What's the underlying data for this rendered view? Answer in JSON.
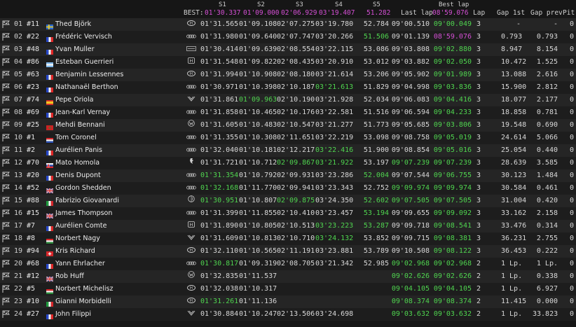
{
  "header": {
    "s1": "S1",
    "s2": "S2",
    "s3": "S3",
    "s4": "S4",
    "s5": "S5",
    "best_label": "BEST:",
    "best_s1": "01'30.337",
    "best_s2": "01'09.000",
    "best_s3": "02'06.929",
    "best_s4": "03'19.407",
    "best_s5": "51.282",
    "last_lap": "Last lap",
    "best_lap": "Best lap",
    "best_lap_time": "08'59.076",
    "lap": "Lap",
    "gap_1st": "Gap 1st",
    "gap_prev": "Gap prev",
    "pit": "Pit"
  },
  "colors": {
    "green": "#4fd44f",
    "purple": "#d44fd4",
    "default": "#d8d8d8"
  },
  "rows": [
    {
      "pos": "01",
      "num": "#11",
      "country": "se",
      "driver": "Thed Björk",
      "logo": "hyundai",
      "s1": "01'31.565",
      "s2": "01'09.108",
      "s3": "02'07.275",
      "s4": "03'19.780",
      "s5": "52.784",
      "last": "09'00.510",
      "best": "09'00.049",
      "lap": "3",
      "gap1": "-",
      "gapp": "-",
      "pit": "0",
      "hl": {
        "best": "green"
      }
    },
    {
      "pos": "02",
      "num": "#22",
      "country": "fr",
      "driver": "Frédéric Vervisch",
      "logo": "audi",
      "s1": "01'31.980",
      "s2": "01'09.640",
      "s3": "02'07.747",
      "s4": "03'20.266",
      "s5": "51.506",
      "last": "09'01.139",
      "best": "08'59.076",
      "lap": "3",
      "gap1": "0.793",
      "gapp": "0.793",
      "pit": "0",
      "hl": {
        "s5": "green",
        "best": "purple"
      }
    },
    {
      "pos": "03",
      "num": "#48",
      "country": "fr",
      "driver": "Yvan Muller",
      "logo": "lynk",
      "s1": "01'30.414",
      "s2": "01'09.639",
      "s3": "02'08.554",
      "s4": "03'22.115",
      "s5": "53.086",
      "last": "09'03.808",
      "best": "09'02.880",
      "lap": "3",
      "gap1": "8.947",
      "gapp": "8.154",
      "pit": "0",
      "hl": {
        "best": "green"
      }
    },
    {
      "pos": "04",
      "num": "#86",
      "country": "ar",
      "driver": "Esteban Guerrieri",
      "logo": "honda",
      "s1": "01'31.548",
      "s2": "01'09.822",
      "s3": "02'08.435",
      "s4": "03'20.910",
      "s5": "53.012",
      "last": "09'03.882",
      "best": "09'02.050",
      "lap": "3",
      "gap1": "10.472",
      "gapp": "1.525",
      "pit": "0",
      "hl": {
        "best": "green"
      }
    },
    {
      "pos": "05",
      "num": "#63",
      "country": "fr",
      "driver": "Benjamin Lessennes",
      "logo": "hyundai",
      "s1": "01'31.994",
      "s2": "01'10.908",
      "s3": "02'08.180",
      "s4": "03'21.614",
      "s5": "53.206",
      "last": "09'05.902",
      "best": "09'01.989",
      "lap": "3",
      "gap1": "13.088",
      "gapp": "2.616",
      "pit": "0",
      "hl": {
        "best": "green"
      }
    },
    {
      "pos": "06",
      "num": "#23",
      "country": "fr",
      "driver": "Nathanaël Berthon",
      "logo": "audi",
      "s1": "01'30.971",
      "s2": "01'10.398",
      "s3": "02'10.187",
      "s4": "03'21.613",
      "s5": "51.829",
      "last": "09'04.998",
      "best": "09'03.836",
      "lap": "3",
      "gap1": "15.900",
      "gapp": "2.812",
      "pit": "0",
      "hl": {
        "s4": "green",
        "best": "green"
      }
    },
    {
      "pos": "07",
      "num": "#74",
      "country": "es",
      "driver": "Pepe Oriola",
      "logo": "cupra",
      "s1": "01'31.861",
      "s2": "01'09.963",
      "s3": "02'10.190",
      "s4": "03'21.928",
      "s5": "52.034",
      "last": "09'06.083",
      "best": "09'04.416",
      "lap": "3",
      "gap1": "18.077",
      "gapp": "2.177",
      "pit": "0",
      "hl": {
        "s2": "green",
        "best": "green"
      }
    },
    {
      "pos": "08",
      "num": "#69",
      "country": "fr",
      "driver": "Jean-Karl Vernay",
      "logo": "audi",
      "s1": "01'31.858",
      "s2": "01'10.465",
      "s3": "02'10.176",
      "s4": "03'22.581",
      "s5": "51.516",
      "last": "09'06.594",
      "best": "09'04.233",
      "lap": "3",
      "gap1": "18.858",
      "gapp": "0.781",
      "pit": "0",
      "hl": {
        "best": "green"
      }
    },
    {
      "pos": "09",
      "num": "#25",
      "country": "ma",
      "driver": "Mehdi Bennani",
      "logo": "vw",
      "s1": "01'31.605",
      "s2": "01'10.483",
      "s3": "02'10.547",
      "s4": "03'21.277",
      "s5": "51.773",
      "last": "09'05.685",
      "best": "09'03.806",
      "lap": "3",
      "gap1": "19.548",
      "gapp": "0.690",
      "pit": "0",
      "hl": {
        "best": "green"
      }
    },
    {
      "pos": "10",
      "num": "#1",
      "country": "nl",
      "driver": "Tom Coronel",
      "logo": "audi",
      "s1": "01'31.355",
      "s2": "01'10.308",
      "s3": "02'11.651",
      "s4": "03'22.219",
      "s5": "53.098",
      "last": "09'08.758",
      "best": "09'05.019",
      "lap": "3",
      "gap1": "24.614",
      "gapp": "5.066",
      "pit": "0",
      "hl": {
        "best": "green"
      }
    },
    {
      "pos": "11",
      "num": "#2",
      "country": "fr",
      "driver": "Aurélien Panis",
      "logo": "audi",
      "s1": "01'32.040",
      "s2": "01'10.181",
      "s3": "02'12.217",
      "s4": "03'22.416",
      "s5": "51.900",
      "last": "09'08.854",
      "best": "09'05.016",
      "lap": "3",
      "gap1": "25.054",
      "gapp": "0.440",
      "pit": "0",
      "hl": {
        "s4": "green",
        "best": "green"
      }
    },
    {
      "pos": "12",
      "num": "#70",
      "country": "sk",
      "driver": "Mato Homola",
      "logo": "peugeot",
      "s1": "01'31.721",
      "s2": "01'10.712",
      "s3": "02'09.867",
      "s4": "03'21.922",
      "s5": "53.197",
      "last": "09'07.239",
      "best": "09'07.239",
      "lap": "3",
      "gap1": "28.639",
      "gapp": "3.585",
      "pit": "0",
      "hl": {
        "s3": "green",
        "s4": "green",
        "last": "green",
        "best": "green"
      }
    },
    {
      "pos": "13",
      "num": "#20",
      "country": "fr",
      "driver": "Denis Dupont",
      "logo": "audi",
      "s1": "01'31.354",
      "s2": "01'10.792",
      "s3": "02'09.931",
      "s4": "03'23.286",
      "s5": "52.004",
      "last": "09'07.544",
      "best": "09'06.755",
      "lap": "3",
      "gap1": "30.123",
      "gapp": "1.484",
      "pit": "0",
      "hl": {
        "s1": "green",
        "s5": "green",
        "best": "green"
      }
    },
    {
      "pos": "14",
      "num": "#52",
      "country": "gb",
      "driver": "Gordon Shedden",
      "logo": "audi",
      "s1": "01'32.168",
      "s2": "01'11.770",
      "s3": "02'09.941",
      "s4": "03'23.343",
      "s5": "52.752",
      "last": "09'09.974",
      "best": "09'09.974",
      "lap": "3",
      "gap1": "30.584",
      "gapp": "0.461",
      "pit": "0",
      "hl": {
        "s1": "green",
        "last": "green",
        "best": "green"
      }
    },
    {
      "pos": "15",
      "num": "#88",
      "country": "it",
      "driver": "Fabrizio Giovanardi",
      "logo": "alfa",
      "s1": "01'30.951",
      "s2": "01'10.807",
      "s3": "02'09.875",
      "s4": "03'24.350",
      "s5": "52.602",
      "last": "09'07.505",
      "best": "09'07.505",
      "lap": "3",
      "gap1": "31.004",
      "gapp": "0.420",
      "pit": "0",
      "hl": {
        "s1": "green",
        "s3": "green",
        "s5": "green",
        "last": "green",
        "best": "green"
      }
    },
    {
      "pos": "16",
      "num": "#15",
      "country": "gb",
      "driver": "James Thompson",
      "logo": "audi",
      "s1": "01'31.399",
      "s2": "01'11.855",
      "s3": "02'10.410",
      "s4": "03'23.457",
      "s5": "53.194",
      "last": "09'09.655",
      "best": "09'09.092",
      "lap": "3",
      "gap1": "33.162",
      "gapp": "2.158",
      "pit": "0",
      "hl": {
        "s5": "green",
        "best": "green"
      }
    },
    {
      "pos": "17",
      "num": "#7",
      "country": "fr",
      "driver": "Aurélien Comte",
      "logo": "honda",
      "s1": "01'31.890",
      "s2": "01'10.805",
      "s3": "02'10.513",
      "s4": "03'23.223",
      "s5": "53.287",
      "last": "09'09.718",
      "best": "09'08.541",
      "lap": "3",
      "gap1": "33.476",
      "gapp": "0.314",
      "pit": "0",
      "hl": {
        "s4": "green",
        "s5": "green",
        "best": "green"
      }
    },
    {
      "pos": "18",
      "num": "#8",
      "country": "hu",
      "driver": "Norbert Nagy",
      "logo": "cupra",
      "s1": "01'31.609",
      "s2": "01'10.813",
      "s3": "02'10.710",
      "s4": "03'24.132",
      "s5": "53.852",
      "last": "09'09.715",
      "best": "09'08.381",
      "lap": "3",
      "gap1": "36.231",
      "gapp": "2.755",
      "pit": "0",
      "hl": {
        "s4": "green",
        "best": "green"
      }
    },
    {
      "pos": "19",
      "num": "#94",
      "country": "ch",
      "driver": "Kris Richard",
      "logo": "hyundai",
      "s1": "01'32.110",
      "s2": "01'10.565",
      "s3": "02'11.191",
      "s4": "03'23.881",
      "s5": "53.789",
      "last": "09'10.508",
      "best": "09'08.122",
      "lap": "3",
      "gap1": "36.453",
      "gapp": "0.222",
      "pit": "0",
      "hl": {
        "best": "green"
      }
    },
    {
      "pos": "20",
      "num": "#68",
      "country": "fr",
      "driver": "Yann Ehrlacher",
      "logo": "audi",
      "s1": "01'30.817",
      "s2": "01'09.319",
      "s3": "02'08.705",
      "s4": "03'21.342",
      "s5": "52.985",
      "last": "09'02.968",
      "best": "09'02.968",
      "lap": "2",
      "gap1": "1 Lp.",
      "gapp": "1 Lp.",
      "pit": "0",
      "hl": {
        "s1": "green",
        "last": "green",
        "best": "green"
      }
    },
    {
      "pos": "21",
      "num": "#12",
      "country": "gb",
      "driver": "Rob Huff",
      "logo": "vw",
      "s1": "01'32.835",
      "s2": "01'11.537",
      "s3": "",
      "s4": "",
      "s5": "",
      "last": "09'02.626",
      "best": "09'02.626",
      "lap": "2",
      "gap1": "1 Lp.",
      "gapp": "0.338",
      "pit": "0",
      "hl": {
        "last": "green",
        "best": "green"
      }
    },
    {
      "pos": "22",
      "num": "#5",
      "country": "hu",
      "driver": "Norbert Michelisz",
      "logo": "hyundai",
      "s1": "01'32.038",
      "s2": "01'10.317",
      "s3": "",
      "s4": "",
      "s5": "",
      "last": "09'04.105",
      "best": "09'04.105",
      "lap": "2",
      "gap1": "1 Lp.",
      "gapp": "6.927",
      "pit": "0",
      "hl": {
        "last": "green",
        "best": "green"
      }
    },
    {
      "pos": "23",
      "num": "#10",
      "country": "it",
      "driver": "Gianni Morbidelli",
      "logo": "hyundai",
      "s1": "01'31.261",
      "s2": "01'11.136",
      "s3": "",
      "s4": "",
      "s5": "",
      "last": "09'08.374",
      "best": "09'08.374",
      "lap": "2",
      "gap1": "11.415",
      "gapp": "0.000",
      "pit": "0",
      "hl": {
        "s1": "green",
        "last": "green",
        "best": "green"
      }
    },
    {
      "pos": "24",
      "num": "#27",
      "country": "fr",
      "driver": "John Filippi",
      "logo": "cupra",
      "s1": "01'30.884",
      "s2": "01'10.247",
      "s3": "02'13.506",
      "s4": "03'24.698",
      "s5": "",
      "last": "09'03.632",
      "best": "09'03.632",
      "lap": "2",
      "gap1": "1 Lp.",
      "gapp": "33.823",
      "pit": "0",
      "hl": {
        "last": "green",
        "best": "green"
      }
    }
  ]
}
